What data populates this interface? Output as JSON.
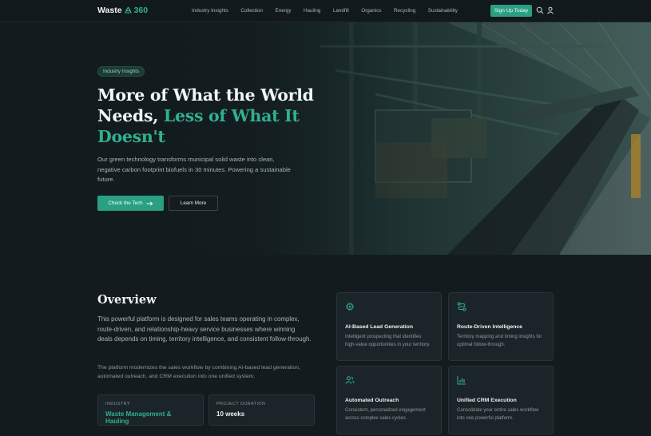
{
  "nav": {
    "logo_word": "Waste",
    "logo_num": "360",
    "links": [
      "Industry Insights",
      "Collection",
      "Energy",
      "Hauling",
      "Landfill",
      "Organics",
      "Recycling",
      "Sustainability"
    ],
    "cta": "Sign Up Today",
    "icons": [
      "search-icon",
      "user-icon"
    ]
  },
  "hero": {
    "badge": "Industry Insights",
    "title_line1": "More of What the World",
    "title_line2a": "Needs, ",
    "title_line2b": "Less of What It",
    "title_line3": "Doesn't",
    "subtitle": "Our green technology transforms municipal solid waste into clean, negative carbon footprint biofuels in 30 minutes. Powering a sustainable future.",
    "primary_button": "Check the Tech",
    "primary_button_icon": "arrow-right-icon",
    "secondary_button": "Learn More"
  },
  "overview": {
    "title": "Overview",
    "paragraph1": "This powerful platform is designed for sales teams operating in complex, route-driven, and relationship-heavy service businesses where winning deals depends on timing, territory intelligence, and consistent follow-through.",
    "paragraph2": "The platform modernizes the sales workflow by combining AI-based lead generation, automated outreach, and CRM execution into one unified system.",
    "stats": [
      {
        "label": "INDUSTRY",
        "value": "Waste Management & Hauling"
      },
      {
        "label": "PROJECT DURATION",
        "value": "10 weeks"
      }
    ],
    "features": [
      {
        "icon": "chip-icon",
        "title": "AI-Based Lead Generation",
        "desc": "Intelligent prospecting that identifies high-value opportunities in your territory."
      },
      {
        "icon": "route-icon",
        "title": "Route-Driven Intelligence",
        "desc": "Territory mapping and timing insights for optimal follow-through."
      },
      {
        "icon": "users-icon",
        "title": "Automated Outreach",
        "desc": "Consistent, personalized engagement across complex sales cycles."
      },
      {
        "icon": "chart-icon",
        "title": "Unified CRM Execution",
        "desc": "Consolidate your entire sales workflow into one powerful platform."
      }
    ]
  },
  "colors": {
    "accent": "#2a9f83",
    "accent_text": "#31b090",
    "background": "#141b1f",
    "card": "#1b2428"
  }
}
